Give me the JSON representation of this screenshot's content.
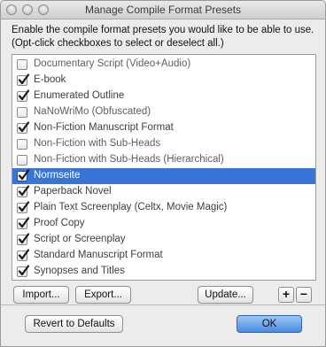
{
  "window": {
    "title": "Manage Compile Format Presets"
  },
  "instructions": "Enable the compile format presets you would like to be able to use. (Opt-click checkboxes to select or deselect all.)",
  "presets": [
    {
      "label": "Documentary Script (Video+Audio)",
      "checked": false,
      "selected": false
    },
    {
      "label": "E-book",
      "checked": true,
      "selected": false
    },
    {
      "label": "Enumerated Outline",
      "checked": true,
      "selected": false
    },
    {
      "label": "NaNoWriMo (Obfuscated)",
      "checked": false,
      "selected": false
    },
    {
      "label": "Non-Fiction Manuscript Format",
      "checked": true,
      "selected": false
    },
    {
      "label": "Non-Fiction with Sub-Heads",
      "checked": false,
      "selected": false
    },
    {
      "label": "Non-Fiction with Sub-Heads (Hierarchical)",
      "checked": false,
      "selected": false
    },
    {
      "label": "Normseite",
      "checked": true,
      "selected": true
    },
    {
      "label": "Paperback Novel",
      "checked": true,
      "selected": false
    },
    {
      "label": "Plain Text Screenplay (Celtx, Movie Magic)",
      "checked": true,
      "selected": false
    },
    {
      "label": "Proof Copy",
      "checked": true,
      "selected": false
    },
    {
      "label": "Script or Screenplay",
      "checked": true,
      "selected": false
    },
    {
      "label": "Standard Manuscript Format",
      "checked": true,
      "selected": false
    },
    {
      "label": "Synopses and Titles",
      "checked": true,
      "selected": false
    }
  ],
  "buttons": {
    "import": "Import...",
    "export": "Export...",
    "update": "Update...",
    "add": "+",
    "remove": "−",
    "revert": "Revert to Defaults",
    "ok": "OK"
  },
  "colors": {
    "selection": "#3875d7",
    "checkmark": "#1a1a1a",
    "ok_button": "#4a8be5"
  }
}
